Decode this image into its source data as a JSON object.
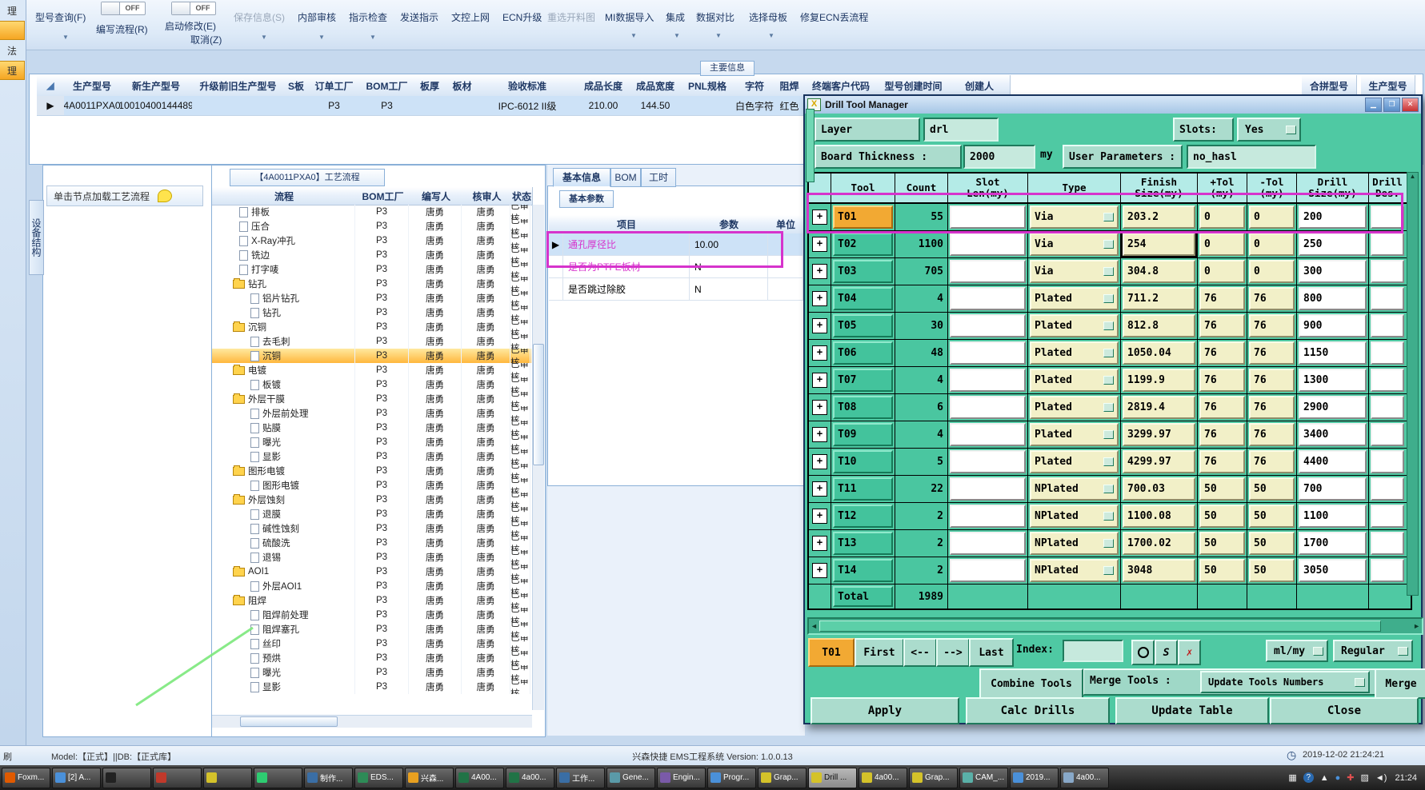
{
  "left_strip": {
    "tabs": [
      "理",
      "法",
      "理"
    ]
  },
  "ribbon": {
    "model_query": "型号查询(F)",
    "write_flow": "编写流程(R)",
    "start_modify": "启动修改(E)",
    "cancel": "取消(Z)",
    "toggle_label": "OFF",
    "save_info": "保存信息(S)",
    "internal_audit": "内部审核",
    "instruction_check": "指示检查",
    "send_instruction": "发送指示",
    "doc_online": "文控上网",
    "ecn_upgrade": "ECN升级",
    "reselect_cut": "重选开料图",
    "mi_import": "MI数据导入",
    "integration": "集成",
    "data_compare": "数据对比",
    "select_mother": "选择母板",
    "fix_ecn": "修复ECN丢流程"
  },
  "main_table": {
    "tab": "主要信息",
    "columns": [
      "生产型号",
      "新生产型号",
      "升级前旧生产型号",
      "S板",
      "订单工厂",
      "BOM工厂",
      "板厚",
      "板材",
      "验收标准",
      "成品长度",
      "成品宽度",
      "PNL规格",
      "字符",
      "阻焊",
      "终端客户代码",
      "型号创建时间",
      "创建人"
    ],
    "row": [
      "4A0011PXA0",
      "10010400144489",
      "",
      "",
      "P3",
      "P3",
      "",
      "",
      "IPC-6012 II级",
      "210.00",
      "144.50",
      "",
      "白色字符",
      "红色",
      "",
      "",
      ""
    ],
    "far_columns": [
      "合拼型号",
      "生产型号"
    ]
  },
  "left_panel": {
    "vertical_tab": "设备结构",
    "hint": "单击节点加载工艺流程"
  },
  "flow_panel": {
    "tab": "【4A0011PXA0】工艺流程",
    "columns": [
      "流程",
      "BOM工厂",
      "编写人",
      "核审人",
      "状态"
    ],
    "defaults": {
      "factory": "P3",
      "writer": "唐勇",
      "auditor": "唐勇",
      "status": "已审核"
    },
    "rows": [
      {
        "n": "排板",
        "k": "leaf"
      },
      {
        "n": "压合",
        "k": "leaf"
      },
      {
        "n": "X-Ray冲孔",
        "k": "leaf"
      },
      {
        "n": "铣边",
        "k": "leaf"
      },
      {
        "n": "打字唛",
        "k": "leaf"
      },
      {
        "n": "钻孔",
        "k": "folder"
      },
      {
        "n": "铝片钻孔",
        "k": "child"
      },
      {
        "n": "钻孔",
        "k": "child"
      },
      {
        "n": "沉铜",
        "k": "folder"
      },
      {
        "n": "去毛刺",
        "k": "child"
      },
      {
        "n": "沉铜",
        "k": "child",
        "sel": true
      },
      {
        "n": "电镀",
        "k": "folder"
      },
      {
        "n": "板镀",
        "k": "child"
      },
      {
        "n": "外层干膜",
        "k": "folder"
      },
      {
        "n": "外层前处理",
        "k": "child"
      },
      {
        "n": "贴膜",
        "k": "child"
      },
      {
        "n": "曝光",
        "k": "child"
      },
      {
        "n": "显影",
        "k": "child"
      },
      {
        "n": "图形电镀",
        "k": "folder"
      },
      {
        "n": "图形电镀",
        "k": "child"
      },
      {
        "n": "外层蚀刻",
        "k": "folder"
      },
      {
        "n": "退膜",
        "k": "child"
      },
      {
        "n": "碱性蚀刻",
        "k": "child"
      },
      {
        "n": "硫酸洗",
        "k": "child"
      },
      {
        "n": "退锡",
        "k": "child"
      },
      {
        "n": "AOI1",
        "k": "folder"
      },
      {
        "n": "外层AOI1",
        "k": "child"
      },
      {
        "n": "阻焊",
        "k": "folder"
      },
      {
        "n": "阻焊前处理",
        "k": "child"
      },
      {
        "n": "阻焊塞孔",
        "k": "child"
      },
      {
        "n": "丝印",
        "k": "child"
      },
      {
        "n": "预烘",
        "k": "child"
      },
      {
        "n": "曝光",
        "k": "child"
      },
      {
        "n": "显影",
        "k": "child"
      }
    ]
  },
  "info_panel": {
    "tabs": [
      "基本信息",
      "BOM",
      "工时"
    ],
    "inner_tab": "基本参数",
    "columns": [
      "项目",
      "参数",
      "单位"
    ],
    "rows": [
      {
        "item": "通孔厚径比",
        "value": "10.00",
        "highlight": true
      },
      {
        "item": "是否为PTFE板材",
        "value": "N",
        "highlight": false
      },
      {
        "item": "是否跳过除胶",
        "value": "N",
        "highlight": false
      }
    ]
  },
  "dialog": {
    "title": "Drill Tool Manager",
    "fields": {
      "layer_label": "Layer            :",
      "layer_value": "drl",
      "slots_label": "Slots:",
      "slots_value": "Yes",
      "thickness_label": "Board Thickness :",
      "thickness_value": "2000",
      "thickness_unit": "my",
      "user_params_label": "User Parameters :",
      "user_params_value": "no_hasl"
    },
    "table": {
      "headers": [
        "",
        "Tool",
        "Count",
        "Slot\nLen(my)",
        "Type",
        "Finish\nSize(my)",
        "+Tol\n(my)",
        "-Tol\n(my)",
        "Drill\nSize(my)",
        "Drill\nDes."
      ],
      "rows": [
        [
          "T01",
          "55",
          "",
          "Via",
          "203.2",
          "0",
          "0",
          "200",
          ""
        ],
        [
          "T02",
          "1100",
          "",
          "Via",
          "254",
          "0",
          "0",
          "250",
          ""
        ],
        [
          "T03",
          "705",
          "",
          "Via",
          "304.8",
          "0",
          "0",
          "300",
          ""
        ],
        [
          "T04",
          "4",
          "",
          "Plated",
          "711.2",
          "76",
          "76",
          "800",
          ""
        ],
        [
          "T05",
          "30",
          "",
          "Plated",
          "812.8",
          "76",
          "76",
          "900",
          ""
        ],
        [
          "T06",
          "48",
          "",
          "Plated",
          "1050.04",
          "76",
          "76",
          "1150",
          ""
        ],
        [
          "T07",
          "4",
          "",
          "Plated",
          "1199.9",
          "76",
          "76",
          "1300",
          ""
        ],
        [
          "T08",
          "6",
          "",
          "Plated",
          "2819.4",
          "76",
          "76",
          "2900",
          ""
        ],
        [
          "T09",
          "4",
          "",
          "Plated",
          "3299.97",
          "76",
          "76",
          "3400",
          ""
        ],
        [
          "T10",
          "5",
          "",
          "Plated",
          "4299.97",
          "76",
          "76",
          "4400",
          ""
        ],
        [
          "T11",
          "22",
          "",
          "NPlated",
          "700.03",
          "50",
          "50",
          "700",
          ""
        ],
        [
          "T12",
          "2",
          "",
          "NPlated",
          "1100.08",
          "50",
          "50",
          "1100",
          ""
        ],
        [
          "T13",
          "2",
          "",
          "NPlated",
          "1700.02",
          "50",
          "50",
          "1700",
          ""
        ],
        [
          "T14",
          "2",
          "",
          "NPlated",
          "3048",
          "50",
          "50",
          "3050",
          ""
        ]
      ],
      "total_label": "Total",
      "total_count": "1989"
    },
    "nav": {
      "current": "T01",
      "first": "First",
      "prev": "<--",
      "next": "-->",
      "last": "Last",
      "index_label": "Index:",
      "unit": "ml/my",
      "mode": "Regular"
    },
    "actions": {
      "combine": "Combine Tools",
      "merge_label": "Merge Tools :",
      "update_numbers": "Update Tools Numbers",
      "merge": "Merge",
      "apply": "Apply",
      "calc": "Calc Drills",
      "update_table": "Update Table",
      "close": "Close"
    }
  },
  "status_bar": {
    "left": "刷",
    "model": "Model:【正式】||DB:【正式库】",
    "center": "兴森快捷 EMS工程系统 Version: 1.0.0.13",
    "time": "2019-12-02 21:24:21"
  },
  "taskbar": {
    "items": [
      {
        "label": "Foxm...",
        "color": "#e05a00"
      },
      {
        "label": "[2] A...",
        "color": "#4a90d9"
      },
      {
        "label": "",
        "color": "#222222"
      },
      {
        "label": "",
        "color": "#c0392b"
      },
      {
        "label": "",
        "color": "#d4c22a"
      },
      {
        "label": "",
        "color": "#2ecc71"
      },
      {
        "label": "制作...",
        "color": "#3a6ea5"
      },
      {
        "label": "EDS...",
        "color": "#2e8b57"
      },
      {
        "label": "兴森...",
        "color": "#e8a020"
      },
      {
        "label": "4A00...",
        "color": "#217346"
      },
      {
        "label": "4a00...",
        "color": "#217346"
      },
      {
        "label": "工作...",
        "color": "#3a6ea5"
      },
      {
        "label": "Gene...",
        "color": "#5a9aa8"
      },
      {
        "label": "Engin...",
        "color": "#7a5aa8"
      },
      {
        "label": "Progr...",
        "color": "#4a90d9"
      },
      {
        "label": "Grap...",
        "color": "#d4c22a"
      },
      {
        "label": "Drill ...",
        "color": "#d4c22a",
        "active": true
      },
      {
        "label": "4a00...",
        "color": "#d4c22a"
      },
      {
        "label": "Grap...",
        "color": "#d4c22a"
      },
      {
        "label": "CAM_...",
        "color": "#5ab0a8"
      },
      {
        "label": "2019...",
        "color": "#4a90d9"
      },
      {
        "label": "4a00...",
        "color": "#88a8c8"
      }
    ],
    "tray_time": "21:24"
  },
  "colors": {
    "dialog_teal": "#4fc9a3",
    "selected_orange": "#f2a933",
    "annotation_magenta": "#d633cc",
    "annotation_green": "#7ce87c"
  }
}
